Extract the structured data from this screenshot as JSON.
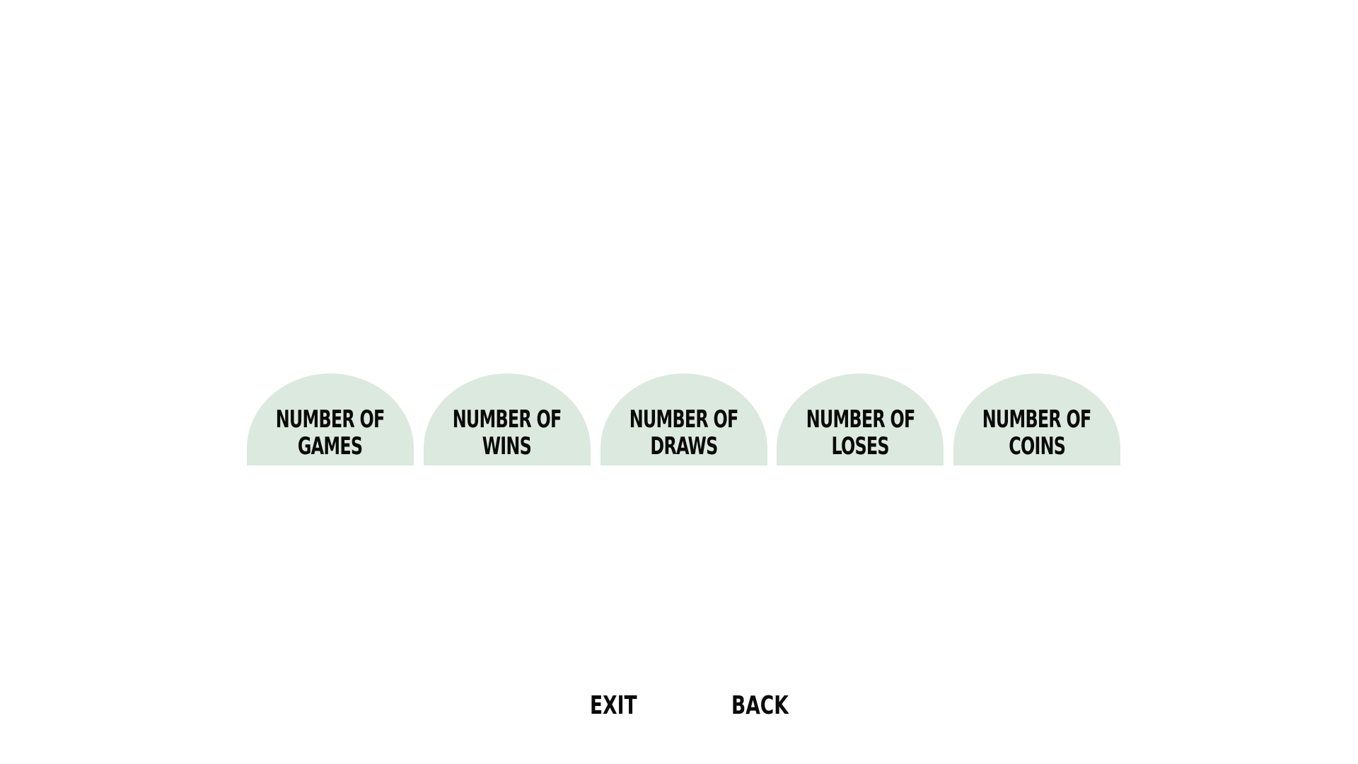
{
  "stats": [
    {
      "line1": "NUMBER OF",
      "line2": "GAMES"
    },
    {
      "line1": "NUMBER OF",
      "line2": "WINS"
    },
    {
      "line1": "NUMBER OF",
      "line2": "DRAWS"
    },
    {
      "line1": "NUMBER OF",
      "line2": "LOSES"
    },
    {
      "line1": "NUMBER OF",
      "line2": "COINS"
    }
  ],
  "nav": {
    "exit_label": "EXIT",
    "back_label": "BACK"
  },
  "colors": {
    "background": "#ffffff",
    "dome_fill": "#dce9de",
    "text": "#0a0a0a"
  }
}
